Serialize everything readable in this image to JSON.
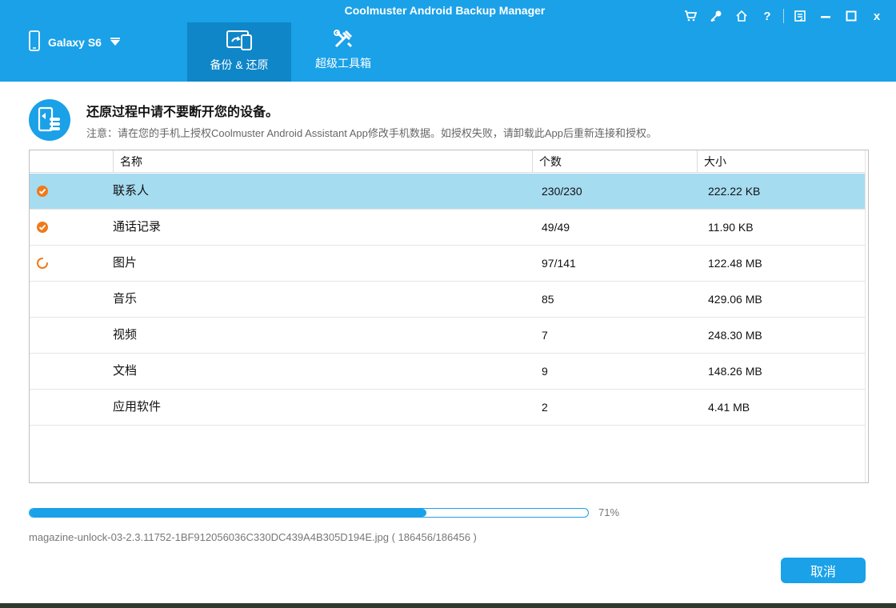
{
  "window": {
    "title": "Coolmuster Android Backup Manager",
    "controls": [
      {
        "name": "cart-icon",
        "glyph": "cart"
      },
      {
        "name": "key-icon",
        "glyph": "key"
      },
      {
        "name": "home-icon",
        "glyph": "home"
      },
      {
        "name": "help-icon",
        "glyph": "?"
      },
      {
        "name": "feedback-icon",
        "glyph": "feedback"
      },
      {
        "name": "minimize-icon",
        "glyph": "minimize"
      },
      {
        "name": "maximize-icon",
        "glyph": "maximize"
      },
      {
        "name": "close-icon",
        "glyph": "x"
      }
    ]
  },
  "device": {
    "name": "Galaxy S6",
    "icon": "phone-icon",
    "dropdown_icon": "caret-down-icon"
  },
  "tabs": [
    {
      "label": "备份 & 还原",
      "icon": "backup-restore-icon",
      "active": true
    },
    {
      "label": "超级工具箱",
      "icon": "toolbox-icon",
      "active": false
    }
  ],
  "notice": {
    "title": "还原过程中请不要断开您的设备。",
    "subtitle": "注意：请在您的手机上授权Coolmuster Android Assistant App修改手机数据。如授权失败，请卸载此App后重新连接和授权。",
    "icon": "phone-database-icon"
  },
  "table": {
    "headers": {
      "name": "名称",
      "count": "个数",
      "size": "大小"
    },
    "rows": [
      {
        "status": "done",
        "name": "联系人",
        "count": "230/230",
        "size": "222.22 KB",
        "selected": true
      },
      {
        "status": "done",
        "name": "通话记录",
        "count": "49/49",
        "size": "11.90 KB",
        "selected": false
      },
      {
        "status": "loading",
        "name": "图片",
        "count": "97/141",
        "size": "122.48 MB",
        "selected": false
      },
      {
        "status": "pending",
        "name": "音乐",
        "count": "85",
        "size": "429.06 MB",
        "selected": false
      },
      {
        "status": "pending",
        "name": "视频",
        "count": "7",
        "size": "248.30 MB",
        "selected": false
      },
      {
        "status": "pending",
        "name": "文档",
        "count": "9",
        "size": "148.26 MB",
        "selected": false
      },
      {
        "status": "pending",
        "name": "应用软件",
        "count": "2",
        "size": "4.41 MB",
        "selected": false
      }
    ]
  },
  "progress": {
    "percent": 71,
    "label": "71%",
    "file": "magazine-unlock-03-2.3.11752-1BF912056036C330DC439A4B305D194E.jpg ( 186456/186456 )"
  },
  "buttons": {
    "cancel": "取消"
  },
  "colors": {
    "accent": "#1aa1e8",
    "selected_row": "#a6dcf0",
    "done": "#f07a1a"
  }
}
